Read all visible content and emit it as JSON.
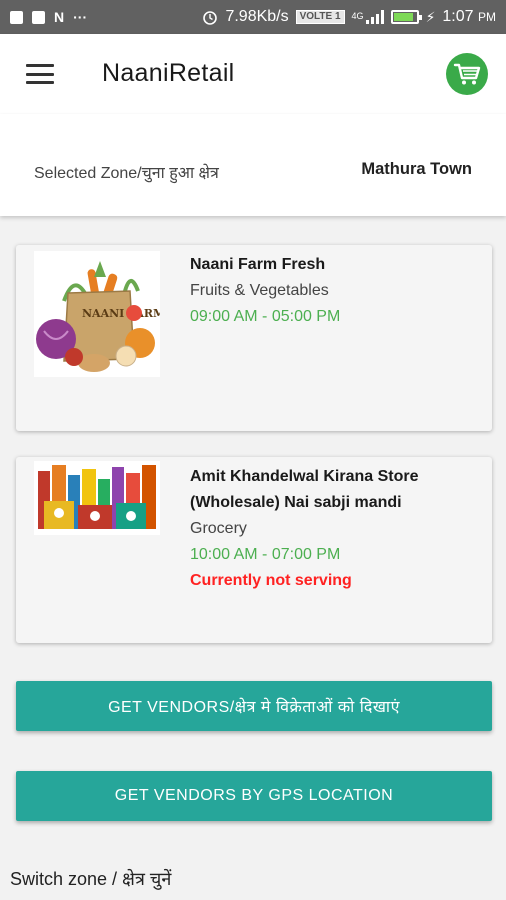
{
  "status_bar": {
    "speed": "7.98Kb/s",
    "volte": "VOLTE 1",
    "net": "4G",
    "time": "1:07",
    "ampm": "PM",
    "battery_level": 0.9
  },
  "app_bar": {
    "title": "NaaniRetail",
    "cart_color": "#3aaa49"
  },
  "zone": {
    "label": "Selected Zone/चुना हुआ क्षेत्र",
    "value": "Mathura Town"
  },
  "vendors": [
    {
      "name": "Naani Farm Fresh",
      "category": "Fruits & Vegetables",
      "hours": "09:00 AM - 05:00 PM",
      "image_icon": "vegetable-bag-icon",
      "image_text": "NAANI FARM FRESH"
    },
    {
      "name": "Amit Khandelwal Kirana Store (Wholesale) Nai sabji mandi",
      "category": "Grocery",
      "hours": "10:00 AM - 07:00 PM",
      "status": "Currently not serving",
      "image_icon": "grocery-products-icon"
    }
  ],
  "buttons": {
    "get_vendors": "GET VENDORS/क्षेत्र मे विक्रेताओं को दिखाएं",
    "get_vendors_gps": "GET VENDORS BY GPS LOCATION",
    "color": "#26a69a"
  },
  "switch_zone": "Switch zone / क्षेत्र चुनें"
}
